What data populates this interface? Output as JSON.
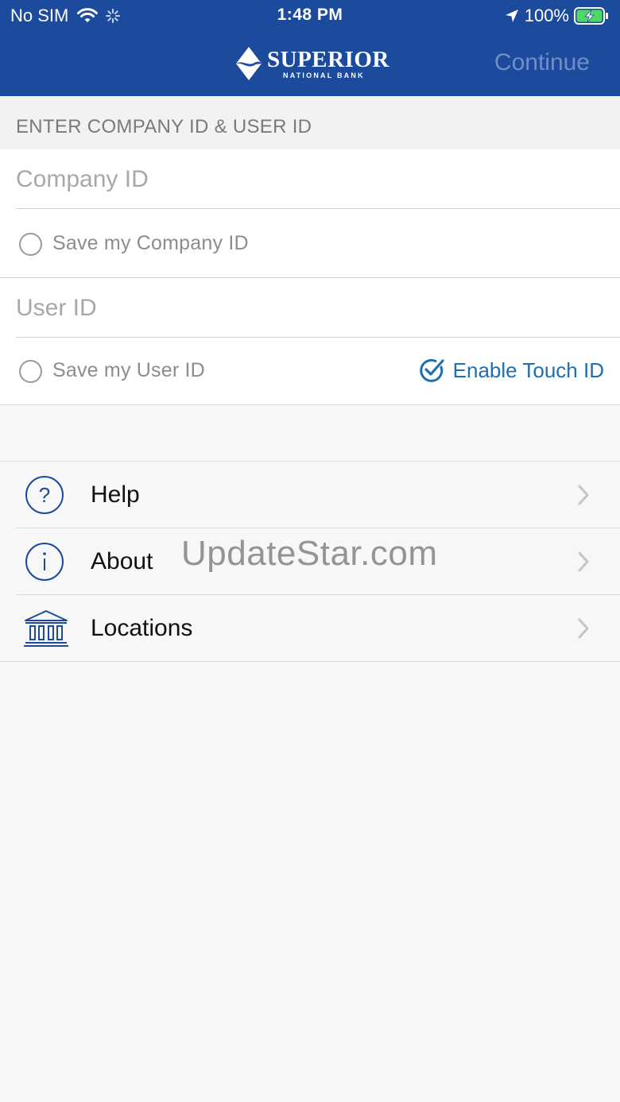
{
  "status_bar": {
    "carrier": "No SIM",
    "time": "1:48 PM",
    "battery": "100%"
  },
  "header": {
    "brand_name": "SUPERIOR",
    "brand_sub": "NATIONAL BANK",
    "continue_label": "Continue"
  },
  "form": {
    "section_title": "ENTER COMPANY ID & USER ID",
    "company_id_placeholder": "Company ID",
    "save_company_label": "Save my Company ID",
    "user_id_placeholder": "User ID",
    "save_user_label": "Save my User ID",
    "touch_id_label": "Enable Touch ID"
  },
  "menu": {
    "items": [
      {
        "label": "Help",
        "icon": "help-circle-icon"
      },
      {
        "label": "About",
        "icon": "info-circle-icon"
      },
      {
        "label": "Locations",
        "icon": "bank-building-icon"
      }
    ]
  },
  "watermark": "UpdateStar.com",
  "colors": {
    "nav_blue": "#1c4a9c",
    "accent_blue": "#1d6fb0",
    "icon_blue": "#1c4a9c"
  }
}
